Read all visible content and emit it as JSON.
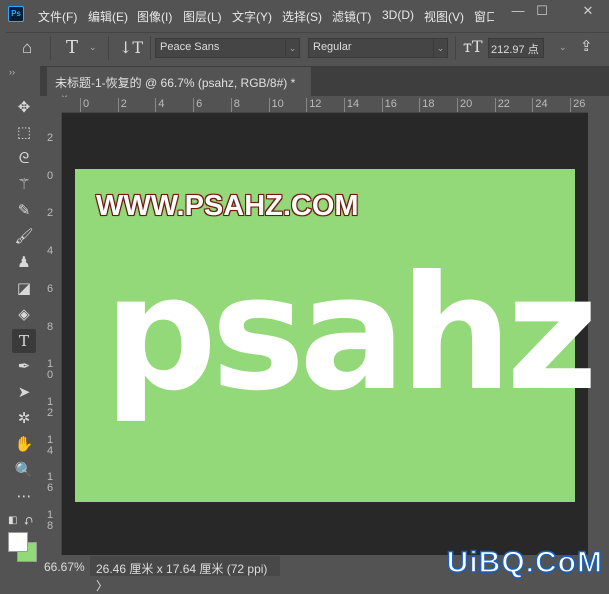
{
  "app": {
    "logo": "Ps"
  },
  "menu": [
    "文件(F)",
    "编辑(E)",
    "图像(I)",
    "图层(L)",
    "文字(Y)",
    "选择(S)",
    "滤镜(T)",
    "3D(D)",
    "视图(V)",
    "窗口"
  ],
  "window_controls": {
    "minimize": "—",
    "maximize": "☐",
    "close": "✕"
  },
  "options": {
    "font_family": "Peace Sans",
    "font_style": "Regular",
    "font_size": "212.97 点"
  },
  "tab": {
    "title": "未标题-1-恢复的 @ 66.7% (psahz, RGB/8#) *",
    "close": "×"
  },
  "rulers": {
    "horizontal": [
      "0",
      "2",
      "4",
      "6",
      "8",
      "10",
      "12",
      "14",
      "16",
      "18",
      "20",
      "22",
      "24",
      "26"
    ],
    "vertical": [
      "2",
      "0",
      "2",
      "4",
      "6",
      "8",
      "10",
      "12",
      "14",
      "16",
      "18"
    ]
  },
  "canvas": {
    "background_color": "#93d97a",
    "text_small": "WWW.PSAHZ.COM",
    "text_big": "psahz"
  },
  "status": {
    "zoom": "66.67%",
    "doc_info": "26.46 厘米 x 17.64 厘米 (72 ppi)",
    "arrow": "〉"
  },
  "colors": {
    "foreground": "#ffffff",
    "background": "#93d97a"
  },
  "watermark": "UiBQ.CoM"
}
